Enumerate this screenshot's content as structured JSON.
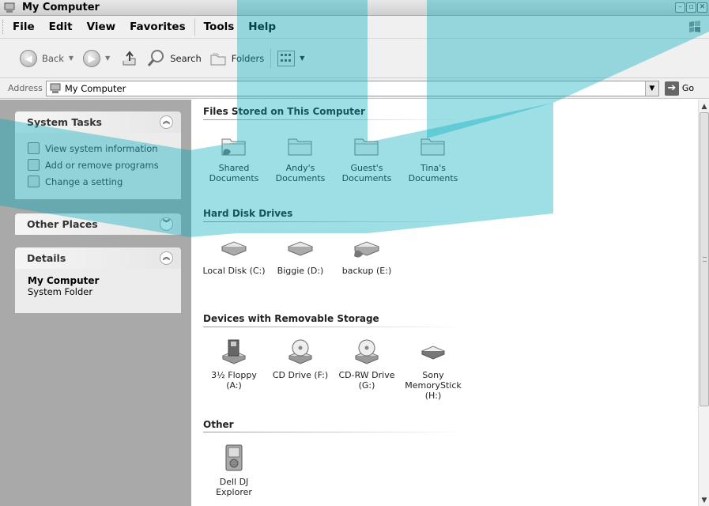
{
  "window": {
    "title": "My Computer"
  },
  "menubar": {
    "items": [
      "File",
      "Edit",
      "View",
      "Favorites",
      "Tools",
      "Help"
    ]
  },
  "toolbar": {
    "back_label": "Back",
    "search_label": "Search",
    "folders_label": "Folders"
  },
  "address": {
    "label": "Address",
    "value": "My Computer",
    "go_label": "Go"
  },
  "taskpane": {
    "system_tasks": {
      "title": "System Tasks",
      "items": [
        "View system information",
        "Add or remove programs",
        "Change a setting"
      ]
    },
    "other_places": {
      "title": "Other Places"
    },
    "details": {
      "title": "Details",
      "name": "My Computer",
      "type": "System Folder"
    }
  },
  "content": {
    "sections": [
      {
        "title": "Files Stored on This Computer",
        "items": [
          {
            "line1": "Shared",
            "line2": "Documents",
            "line3": ""
          },
          {
            "line1": "Andy's",
            "line2": "Documents",
            "line3": ""
          },
          {
            "line1": "Guest's",
            "line2": "Documents",
            "line3": ""
          },
          {
            "line1": "Tina's",
            "line2": "Documents",
            "line3": ""
          }
        ]
      },
      {
        "title": "Hard Disk Drives",
        "items": [
          {
            "line1": "Local Disk (C:)",
            "line2": "",
            "line3": ""
          },
          {
            "line1": "Biggie (D:)",
            "line2": "",
            "line3": ""
          },
          {
            "line1": "backup (E:)",
            "line2": "",
            "line3": ""
          }
        ]
      },
      {
        "title": "Devices with Removable Storage",
        "items": [
          {
            "line1": "3½ Floppy",
            "line2": "(A:)",
            "line3": ""
          },
          {
            "line1": "CD Drive (F:)",
            "line2": "",
            "line3": ""
          },
          {
            "line1": "CD-RW Drive",
            "line2": "(G:)",
            "line3": ""
          },
          {
            "line1": "Sony",
            "line2": "MemoryStick",
            "line3": "(H:)"
          }
        ]
      },
      {
        "title": "Other",
        "items": [
          {
            "line1": "Dell DJ",
            "line2": "Explorer",
            "line3": ""
          }
        ]
      }
    ]
  },
  "icons": {
    "title": "my-computer-icon",
    "back": "back-arrow-icon",
    "forward": "forward-arrow-icon",
    "up": "up-folder-icon",
    "search": "search-magnifier-icon",
    "folders": "folders-icon",
    "views": "views-grid-icon",
    "go": "go-arrow-icon",
    "folder": "folder-icon",
    "shared_folder": "shared-folder-icon",
    "hard_disk": "hard-disk-icon",
    "floppy": "floppy-drive-icon",
    "cd": "cd-drive-icon",
    "memory_stick": "memory-stick-icon",
    "media_player": "media-player-icon"
  },
  "colors": {
    "taskpane_bg": "#a9a9a9",
    "panel_bg": "#ececec",
    "watermark": "#00aabb"
  }
}
